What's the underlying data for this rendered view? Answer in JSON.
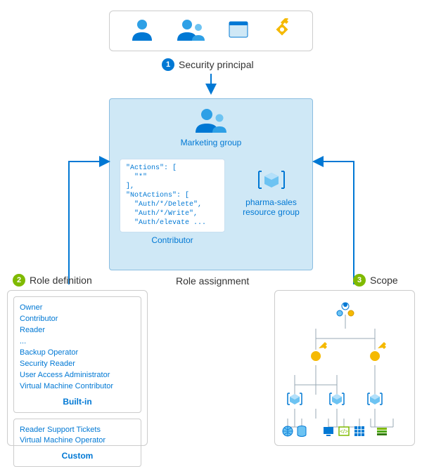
{
  "sections": {
    "security_principal": {
      "badge": "1",
      "title": "Security principal"
    },
    "role_definition": {
      "badge": "2",
      "title": "Role definition"
    },
    "role_assignment": {
      "title": "Role assignment"
    },
    "scope": {
      "badge": "3",
      "title": "Scope"
    }
  },
  "principal_icons": [
    "user-icon",
    "group-icon",
    "app-icon",
    "key-icon"
  ],
  "assignment": {
    "group_label": "Marketing group",
    "contributor_label": "Contributor",
    "code": "\"Actions\": [\n  \"*\"\n],\n\"NotActions\": [\n  \"Auth/*/Delete\",\n  \"Auth/*/Write\",\n  \"Auth/elevate ...",
    "resource_group_line1": "pharma-sales",
    "resource_group_line2": "resource group"
  },
  "roles": {
    "builtin_label": "Built-in",
    "builtin": [
      "Owner",
      "Contributor",
      "Reader",
      "...",
      "Backup Operator",
      "Security Reader",
      "User Access Administrator",
      "Virtual Machine Contributor"
    ],
    "custom_label": "Custom",
    "custom": [
      "Reader Support Tickets",
      "Virtual Machine Operator"
    ]
  }
}
